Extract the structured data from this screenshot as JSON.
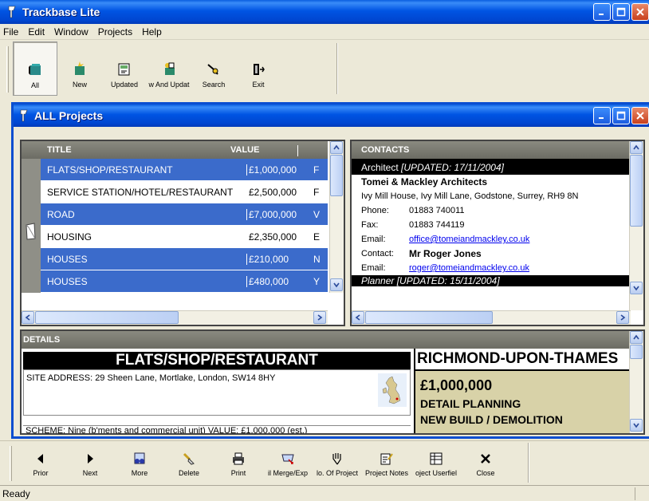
{
  "window": {
    "title": "Trackbase Lite"
  },
  "menu": [
    "File",
    "Edit",
    "Window",
    "Projects",
    "Help"
  ],
  "toolbar": [
    {
      "label": "All",
      "icon": "all-projects-icon",
      "selected": true
    },
    {
      "label": "New",
      "icon": "new-projects-icon"
    },
    {
      "label": "Updated",
      "icon": "updated-projects-icon"
    },
    {
      "label": "w And Updat",
      "icon": "new-and-updated-icon"
    },
    {
      "label": "Search",
      "icon": "search-icon"
    },
    {
      "label": "Exit",
      "icon": "exit-icon"
    }
  ],
  "inner_window": {
    "title": "ALL Projects"
  },
  "projects": {
    "columns": [
      "TITLE",
      "VALUE"
    ],
    "rows": [
      {
        "title": "FLATS/SHOP/RESTAURANT",
        "value": "£1,000,000",
        "extra": "F",
        "selected": true
      },
      {
        "title": "SERVICE STATION/HOTEL/RESTAURANT",
        "value": "£2,500,000",
        "extra": "F",
        "selected": false
      },
      {
        "title": "ROAD",
        "value": "£7,000,000",
        "extra": "V",
        "selected": true
      },
      {
        "title": "HOUSING",
        "value": "£2,350,000",
        "extra": "E",
        "selected": false
      },
      {
        "title": "HOUSES",
        "value": "£210,000",
        "extra": "N",
        "selected": true
      },
      {
        "title": "HOUSES",
        "value": "£480,000",
        "extra": "Y",
        "selected": true
      }
    ]
  },
  "contacts": {
    "header": "CONTACTS",
    "role1": "Architect",
    "updated1": "[UPDATED: 17/11/2004]",
    "company": "Tomei & Mackley Architects",
    "address": "Ivy Mill House, Ivy Mill Lane, Godstone, Surrey, RH9 8N",
    "phone_label": "Phone:",
    "phone": "01883 740011",
    "fax_label": "Fax:",
    "fax": "01883 744119",
    "email_label": "Email:",
    "email": "office@tomeiandmackley.co.uk",
    "contact_label": "Contact:",
    "contact": "Mr Roger Jones",
    "email2_label": "Email:",
    "email2": "roger@tomeiandmackley.co.uk",
    "role2": "Planner [UPDATED: 15/11/2004]"
  },
  "details": {
    "header": "DETAILS",
    "title": "FLATS/SHOP/RESTAURANT",
    "site_address": "SITE ADDRESS: 29 Sheen Lane, Mortlake, London, SW14 8HY",
    "scheme": "SCHEME: Nine (b'ments and commercial unit) VALUE: £1,000,000 (est.)",
    "area": "RICHMOND-UPON-THAMES",
    "value": "£1,000,000",
    "stage": "DETAIL PLANNING",
    "type": "NEW BUILD / DEMOLITION"
  },
  "bottom_toolbar": [
    {
      "label": "Prior",
      "icon": "prior-arrow-icon"
    },
    {
      "label": "Next",
      "icon": "next-arrow-icon"
    },
    {
      "label": "More",
      "icon": "more-binoculars-icon"
    },
    {
      "label": "Delete",
      "icon": "delete-eraser-icon"
    },
    {
      "label": "Print",
      "icon": "printer-icon"
    },
    {
      "label": "il Merge/Exp",
      "icon": "mail-merge-icon"
    },
    {
      "label": "lo. Of Project",
      "icon": "number-of-projects-icon"
    },
    {
      "label": "Project Notes",
      "icon": "project-notes-icon"
    },
    {
      "label": "oject Userfiel",
      "icon": "user-fields-icon"
    },
    {
      "label": "Close",
      "icon": "close-x-icon"
    }
  ],
  "status": {
    "text": "Ready"
  },
  "colors": {
    "titlebar": "#0054e3",
    "selected_row": "#3b6bcb",
    "grid_header": "#6c6c64",
    "details_right": "#d8d2a8"
  }
}
